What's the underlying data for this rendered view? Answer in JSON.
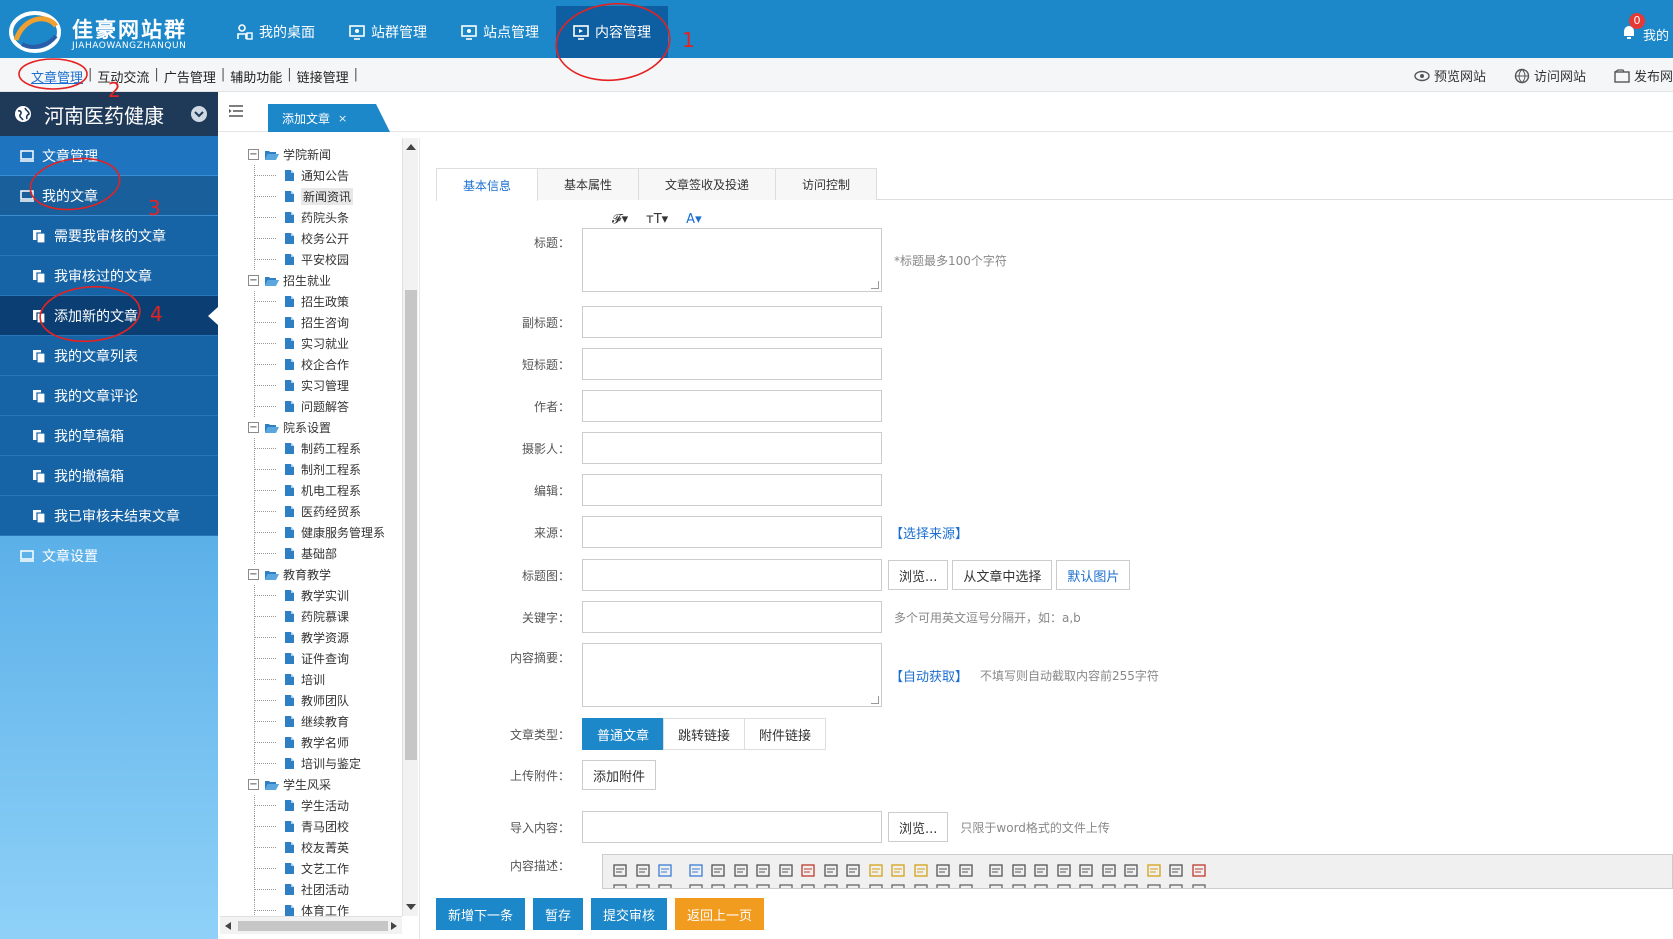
{
  "app": {
    "name": "佳豪网站群",
    "pinyin": "JIAHAOWANGZHANQUN"
  },
  "topnav": [
    {
      "label": "我的桌面",
      "icon": "user-desk-icon"
    },
    {
      "label": "站群管理",
      "icon": "monitor-icon"
    },
    {
      "label": "站点管理",
      "icon": "monitor-icon"
    },
    {
      "label": "内容管理",
      "icon": "monitor-content-icon",
      "active": true
    }
  ],
  "notify": {
    "count": "0",
    "label": "我的"
  },
  "submenu": {
    "items": [
      "文章管理",
      "互动交流",
      "广告管理",
      "辅助功能",
      "链接管理"
    ],
    "active": "文章管理",
    "sep": "|"
  },
  "subtools": [
    "预览网站",
    "访问网站",
    "发布网"
  ],
  "sidebar": {
    "site": "河南医药健康",
    "items": [
      {
        "label": "文章管理",
        "level": 1
      },
      {
        "label": "我的文章",
        "level": 1,
        "open": true
      },
      {
        "label": "需要我审核的文章",
        "level": 2
      },
      {
        "label": "我审核过的文章",
        "level": 2
      },
      {
        "label": "添加新的文章",
        "level": 2,
        "active": true
      },
      {
        "label": "我的文章列表",
        "level": 2
      },
      {
        "label": "我的文章评论",
        "level": 2
      },
      {
        "label": "我的草稿箱",
        "level": 2
      },
      {
        "label": "我的撤稿箱",
        "level": 2
      },
      {
        "label": "我已审核未结束文章",
        "level": 2
      },
      {
        "label": "文章设置",
        "level": 1
      }
    ]
  },
  "tab": {
    "label": "添加文章",
    "close": "×"
  },
  "tree": [
    {
      "label": "学院新闻",
      "children": [
        "通知公告",
        "新闻资讯",
        "药院头条",
        "校务公开",
        "平安校园"
      ],
      "selected": "新闻资讯"
    },
    {
      "label": "招生就业",
      "children": [
        "招生政策",
        "招生咨询",
        "实习就业",
        "校企合作",
        "实习管理",
        "问题解答"
      ]
    },
    {
      "label": "院系设置",
      "children": [
        "制药工程系",
        "制剂工程系",
        "机电工程系",
        "医药经贸系",
        "健康服务管理系",
        "基础部"
      ]
    },
    {
      "label": "教育教学",
      "children": [
        "教学实训",
        "药院慕课",
        "教学资源",
        "证件查询",
        "培训",
        "教师团队",
        "继续教育",
        "教学名师",
        "培训与鉴定"
      ]
    },
    {
      "label": "学生风采",
      "children": [
        "学生活动",
        "青马团校",
        "校友菁英",
        "文艺工作",
        "社团活动",
        "体育工作"
      ]
    }
  ],
  "form": {
    "tabs": [
      "基本信息",
      "基本属性",
      "文章签收及投递",
      "访问控制"
    ],
    "active_tab": "基本信息",
    "format_tools": [
      "𝓕▾",
      "тT▾",
      "A▾"
    ],
    "fields": {
      "title": {
        "label": "标题：",
        "hint": "*标题最多100个字符"
      },
      "subtitle": {
        "label": "副标题："
      },
      "short_title": {
        "label": "短标题："
      },
      "author": {
        "label": "作者："
      },
      "photographer": {
        "label": "摄影人："
      },
      "editor": {
        "label": "编辑："
      },
      "source": {
        "label": "来源：",
        "link": "【选择来源】"
      },
      "title_image": {
        "label": "标题图：",
        "browse": "浏览...",
        "from_article": "从文章中选择",
        "default": "默认图片"
      },
      "keywords": {
        "label": "关键字：",
        "hint": "多个可用英文逗号分隔开，如：a,b"
      },
      "summary": {
        "label": "内容摘要：",
        "link": "【自动获取】",
        "hint": "不填写则自动截取内容前255字符"
      },
      "article_type": {
        "label": "文章类型：",
        "options": [
          "普通文章",
          "跳转链接",
          "附件链接"
        ],
        "selected": "普通文章"
      },
      "attachment": {
        "label": "上传附件：",
        "button": "添加附件"
      },
      "import": {
        "label": "导入内容：",
        "browse": "浏览...",
        "hint": "只限于word格式的文件上传"
      },
      "content": {
        "label": "内容描述："
      }
    }
  },
  "actions": [
    "新增下一条",
    "暂存",
    "提交审核",
    "返回上一页"
  ],
  "annotations": [
    "1",
    "2",
    "3",
    "4"
  ]
}
